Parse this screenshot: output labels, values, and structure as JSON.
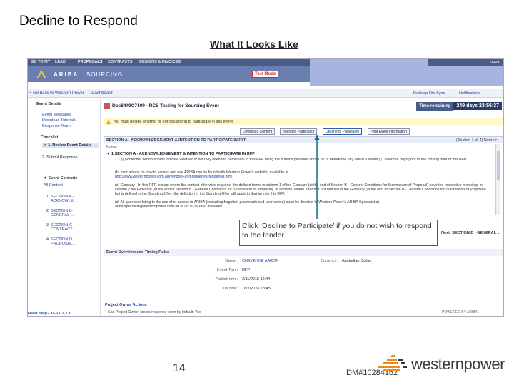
{
  "slide": {
    "title": "Decline to Respond",
    "subtitle": "What It Looks Like",
    "page_number": "14",
    "doc_ref": "DM#10284162",
    "logo_text": "westernpower"
  },
  "app": {
    "top_nav": [
      "GO TO MY",
      "LEAD",
      "PROPOSALS",
      "CONTRACTS",
      "DESIGNS & INVOICES"
    ],
    "logout_label": "logout",
    "brand": "ARIBA",
    "product": "SOURCING",
    "test_mode_label": "Test Mode",
    "breadcrumb": "< Go back to Western Power - T Dashboard",
    "crumb_right": [
      "Desktop File Sync",
      "Notifications"
    ],
    "doc_title": "Doc6449C7409 - RCS Testing for Sourcing Event",
    "time_label": "Time remaining",
    "time_value": "249 days 23:56:37",
    "notice": "You must decide whether or not you intend to participate in this event.",
    "buttons": {
      "download": "Download Content",
      "intend": "Intend to Participate",
      "decline": "Decline to Participate",
      "print": "Print Event Information"
    },
    "section_header": "SECTION A - ACKNOWLEDGEMENT & INTENTION TO PARTICIPATE IN RFP",
    "section_pager": "(Section 1 of 4)  Next >>",
    "col_name": "Name ↑",
    "section_row": "▼  1   SECTION A - ACKNOWLEDGEMENT & INTENTION TO PARTICIPATE IN RFP",
    "paragraphs": [
      "1.1   (a)  Potential Vendors must indicate whether or not they intend to participate in this RFP using the buttons provided above on or before the day which a seven (7) calendar days prior to the closing date of this RFP.",
      "(b) Instructions on how to access and use ARIBA can be found with Western Power's website, available at",
      "http://www.westernpower.com.au/vendors-and-tenderers-tendering.html",
      "(c) Glossary - In this RFP, except where the context otherwise requires, the defined terms in column 1 of the Glossary (at the end of Section B - General Conditions for Submission of Proposal) have the respective meanings in column 2 the Glossary (at the end of Section B - General Conditions for Submission of Proposal). In addition, where a term is not defined in the Glossary (at the end of Section B - General Conditions for Submission of Proposal) but is defined in the Standing Offer, the definition in the Standing Offer will apply to that term in this RFP.",
      "(d) All queries relating to the use of or access to ARIBA (excluding forgotten passwords and usernames) must be directed to Western Power's ARIBA Specialist at",
      "ariba.specialist@westernpower.com.au or 08 9326 6691 between"
    ],
    "section_b_label": "Next: SECTION B - GENERAL ...",
    "sidebar": {
      "event_details": "Event Details",
      "links": [
        "Event Messages",
        "Download Tutorials",
        "Response Team"
      ],
      "checklist": "Checklist",
      "steps": [
        "✔ 1. Review Event Details",
        "2. Submit Response"
      ],
      "event_contents": "▼ Event Contents",
      "all_content": "All Content",
      "sections": [
        {
          "num": "1",
          "label": "SECTION A - ACKNOWLE..."
        },
        {
          "num": "2",
          "label": "SECTION B - GENERAL ..."
        },
        {
          "num": "3",
          "label": "SECTION C - CONTRACT..."
        },
        {
          "num": "4",
          "label": "SECTION D - PROPOSAL..."
        }
      ],
      "help": "Need Help? TEST 1,2,3"
    },
    "event_overview_header": "Event Overview and Timing Rules",
    "overview": {
      "owner_k": "Owner:",
      "owner_v": "CHEYENNE AARON",
      "type_k": "Event Type:",
      "type_v": "RFP",
      "publish_k": "Publish time:",
      "publish_v": "3/11/2015 12:44",
      "due_k": "Due date:",
      "due_v": "16/7/2016 13:45",
      "currency_k": "Currency:",
      "currency_v": "Australian Dollar"
    },
    "project_owner_header": "Project Owner Actions",
    "project_owner_text": "Can Project Owner create response team by default:   Yes",
    "powered_by": "POWERED BY ARIBA"
  },
  "callout": {
    "text": "Click ‘Decline to Participate’ if you do not wish to respond to the tender."
  },
  "colors": {
    "nav_dark": "#4a5d8a",
    "nav_brand": "#6a7fb0",
    "highlight_block": "#a7b3e0",
    "callout_border": "#e02020",
    "arrow": "#0b6e8a",
    "time_value_bg": "#2b3a66"
  }
}
